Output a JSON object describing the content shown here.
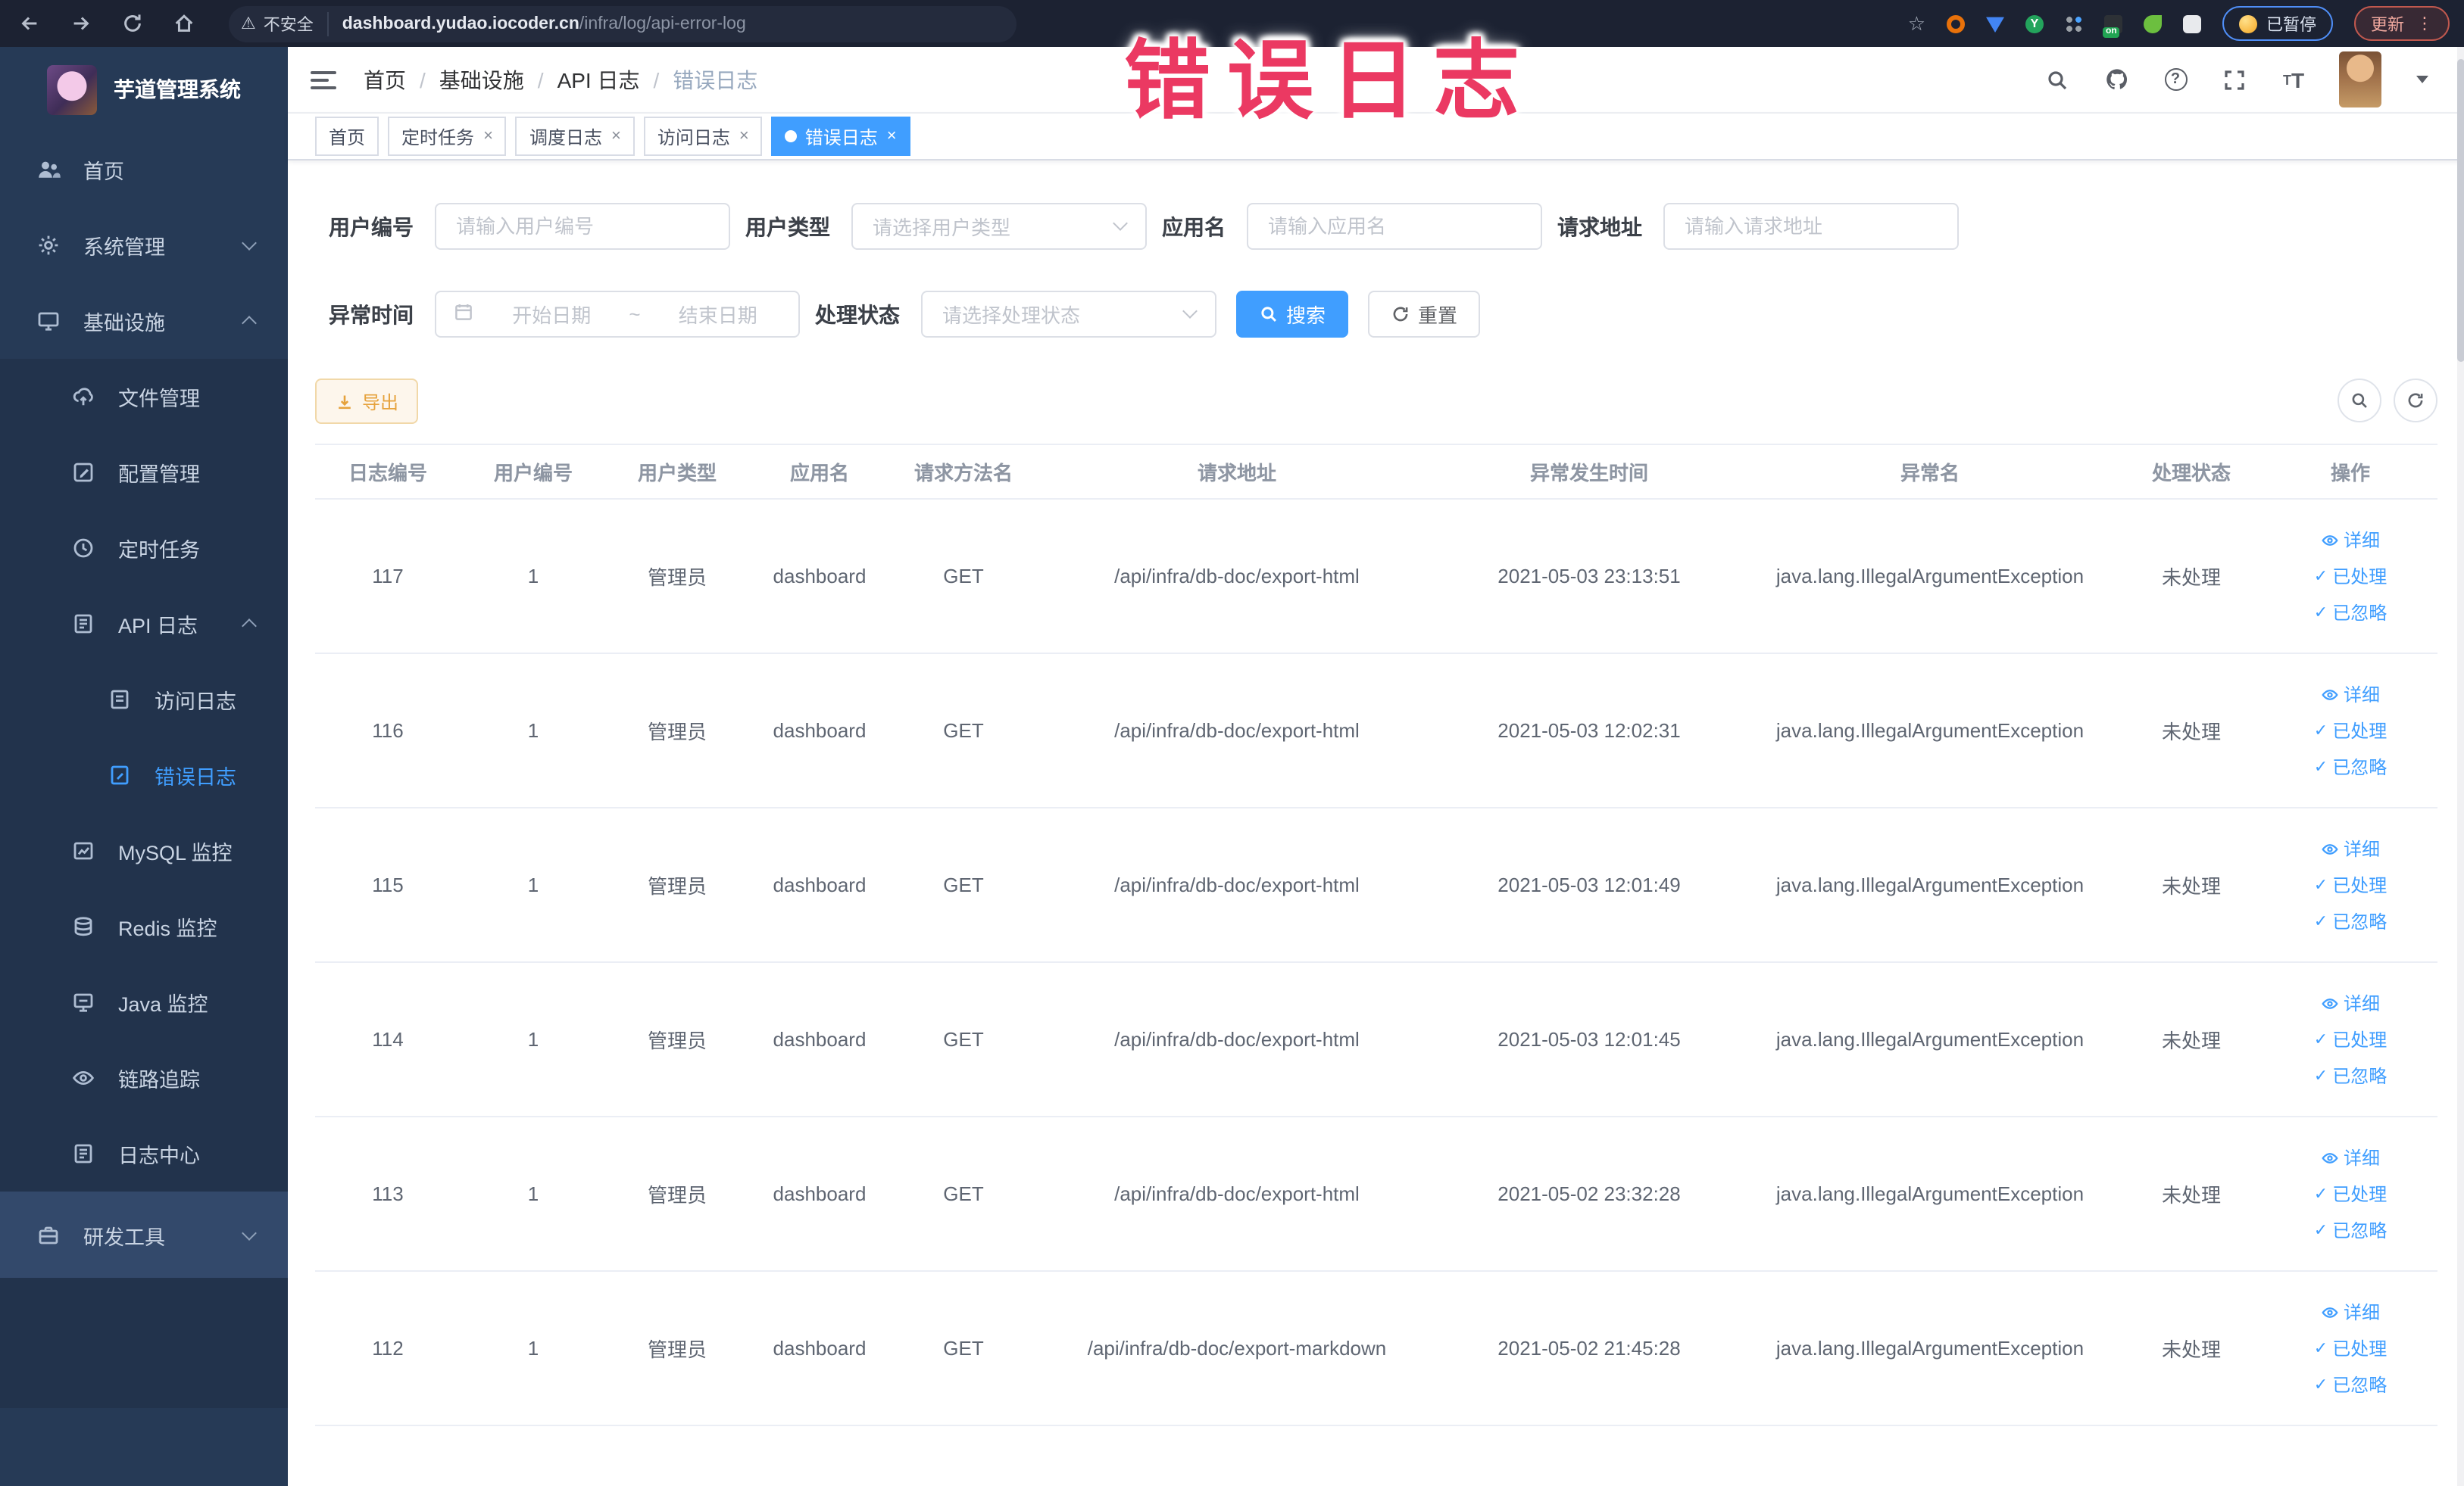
{
  "colors": {
    "accent": "#409eff",
    "overlay_red": "#eb3962",
    "warning": "#e6a23c",
    "sidebar_bg": "#263a56"
  },
  "browser": {
    "security_chip": "不安全",
    "url_host": "dashboard.yudao.iocoder.cn",
    "url_path": "/infra/log/api-error-log",
    "paused_badge": "已暂停",
    "update_button": "更新"
  },
  "overlay": {
    "text": "错误日志"
  },
  "sidebar": {
    "title": "芋道管理系统",
    "items": [
      {
        "label": "首页"
      },
      {
        "label": "系统管理"
      },
      {
        "label": "基础设施"
      },
      {
        "label": "文件管理"
      },
      {
        "label": "配置管理"
      },
      {
        "label": "定时任务"
      },
      {
        "label": "API 日志"
      },
      {
        "label": "访问日志"
      },
      {
        "label": "错误日志"
      },
      {
        "label": "MySQL 监控"
      },
      {
        "label": "Redis 监控"
      },
      {
        "label": "Java 监控"
      },
      {
        "label": "链路追踪"
      },
      {
        "label": "日志中心"
      },
      {
        "label": "研发工具"
      }
    ]
  },
  "breadcrumb": {
    "items": [
      "首页",
      "基础设施",
      "API 日志",
      "错误日志"
    ]
  },
  "tabs": [
    {
      "label": "首页"
    },
    {
      "label": "定时任务"
    },
    {
      "label": "调度日志"
    },
    {
      "label": "访问日志"
    },
    {
      "label": "错误日志"
    }
  ],
  "filters": {
    "user_id_label": "用户编号",
    "user_id_placeholder": "请输入用户编号",
    "user_type_label": "用户类型",
    "user_type_placeholder": "请选择用户类型",
    "app_label": "应用名",
    "app_placeholder": "请输入应用名",
    "url_label": "请求地址",
    "url_placeholder": "请输入请求地址",
    "time_label": "异常时间",
    "time_start": "开始日期",
    "time_sep": "~",
    "time_end": "结束日期",
    "status_label": "处理状态",
    "status_placeholder": "请选择处理状态",
    "search_label": "搜索",
    "reset_label": "重置"
  },
  "toolbar": {
    "export_label": "导出"
  },
  "table": {
    "headers": [
      "日志编号",
      "用户编号",
      "用户类型",
      "应用名",
      "请求方法名",
      "请求地址",
      "异常发生时间",
      "异常名",
      "处理状态",
      "操作"
    ],
    "actions": {
      "detail": "详细",
      "processed": "已处理",
      "ignored": "已忽略"
    },
    "rows": [
      {
        "id": "117",
        "user_id": "1",
        "user_type": "管理员",
        "app": "dashboard",
        "method": "GET",
        "url": "/api/infra/db-doc/export-html",
        "time": "2021-05-03 23:13:51",
        "exception": "java.lang.IllegalArgumentException",
        "status": "未处理"
      },
      {
        "id": "116",
        "user_id": "1",
        "user_type": "管理员",
        "app": "dashboard",
        "method": "GET",
        "url": "/api/infra/db-doc/export-html",
        "time": "2021-05-03 12:02:31",
        "exception": "java.lang.IllegalArgumentException",
        "status": "未处理"
      },
      {
        "id": "115",
        "user_id": "1",
        "user_type": "管理员",
        "app": "dashboard",
        "method": "GET",
        "url": "/api/infra/db-doc/export-html",
        "time": "2021-05-03 12:01:49",
        "exception": "java.lang.IllegalArgumentException",
        "status": "未处理"
      },
      {
        "id": "114",
        "user_id": "1",
        "user_type": "管理员",
        "app": "dashboard",
        "method": "GET",
        "url": "/api/infra/db-doc/export-html",
        "time": "2021-05-03 12:01:45",
        "exception": "java.lang.IllegalArgumentException",
        "status": "未处理"
      },
      {
        "id": "113",
        "user_id": "1",
        "user_type": "管理员",
        "app": "dashboard",
        "method": "GET",
        "url": "/api/infra/db-doc/export-html",
        "time": "2021-05-02 23:32:28",
        "exception": "java.lang.IllegalArgumentException",
        "status": "未处理"
      },
      {
        "id": "112",
        "user_id": "1",
        "user_type": "管理员",
        "app": "dashboard",
        "method": "GET",
        "url": "/api/infra/db-doc/export-markdown",
        "time": "2021-05-02 21:45:28",
        "exception": "java.lang.IllegalArgumentException",
        "status": "未处理"
      }
    ]
  }
}
